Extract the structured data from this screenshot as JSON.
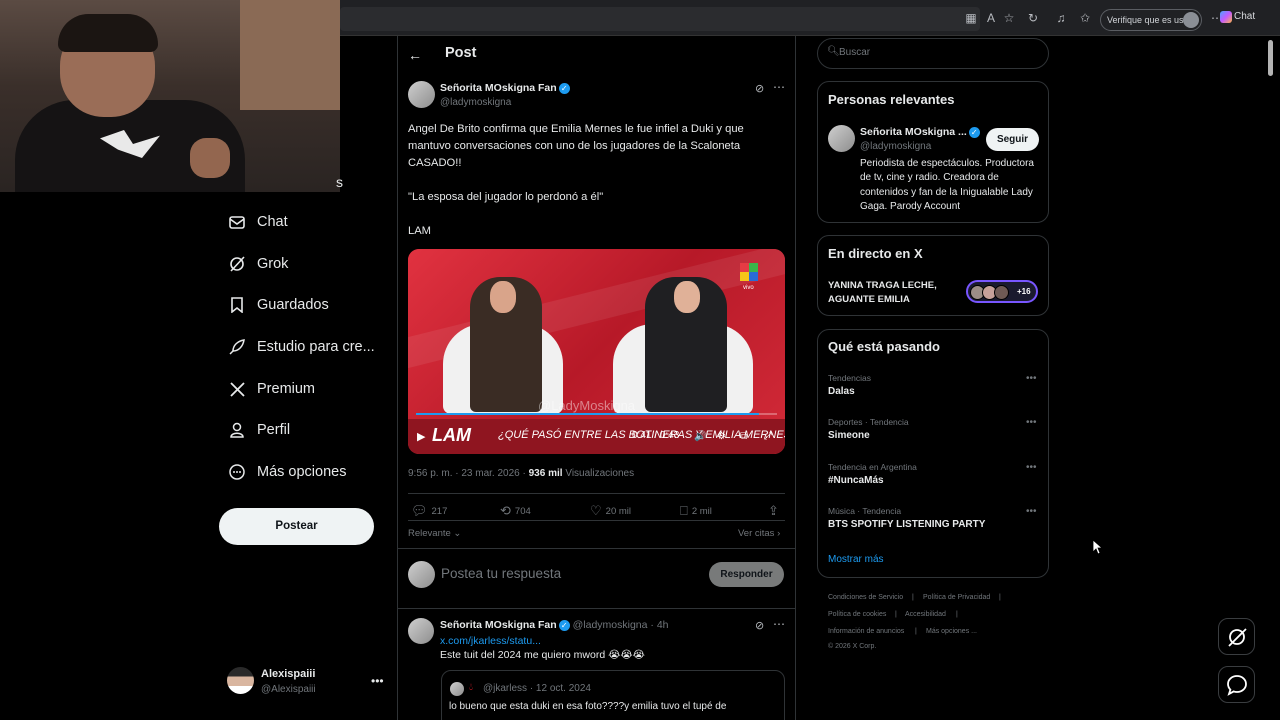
{
  "browser": {
    "verify_label": "Verifique que es usted",
    "copilot_label": "Chat"
  },
  "nav": {
    "partial_label": "s",
    "items": [
      {
        "label": "Chat",
        "icon": "mail-icon"
      },
      {
        "label": "Grok",
        "icon": "grok-icon"
      },
      {
        "label": "Guardados",
        "icon": "bookmark-icon"
      },
      {
        "label": "Estudio para cre...",
        "icon": "rocket-icon"
      },
      {
        "label": "Premium",
        "icon": "x-logo-icon"
      },
      {
        "label": "Perfil",
        "icon": "person-icon"
      },
      {
        "label": "Más opciones",
        "icon": "more-circle-icon"
      }
    ],
    "post_button": "Postear",
    "account": {
      "name": "Alexispaiii",
      "handle": "@Alexispaiii"
    }
  },
  "post_page": {
    "title": "Post",
    "tweet": {
      "author_name": "Señorita MOskigna Fan",
      "author_handle": "@ladymoskigna",
      "paragraphs": [
        "Angel De Brito confirma que Emilia Mernes le fue infiel a Duki y que mantuvo conversaciones con uno de los jugadores de la Scaloneta CASADO!!",
        "\"La esposa del jugador lo perdonó a él\"",
        "LAM"
      ],
      "media": {
        "watermark": "@LadyMoskigna",
        "channel_tag": "vivo",
        "show_logo": "LAM",
        "ticker": "¿QUÉ PASÓ ENTRE LAS BOTINERAS Y EMILIA MERNES?",
        "time": "0:41 / 0:43",
        "progress": 0.95
      },
      "time": "9:56 p. m. · 23 mar. 2026 ·",
      "views_count": "936 mil",
      "views_label": "Visualizaciones",
      "actions": {
        "replies": "217",
        "reposts": "704",
        "likes": "20 mil",
        "bookmarks": "2 mil"
      },
      "sort_label": "Relevante",
      "quotes_label": "Ver citas"
    },
    "reply": {
      "placeholder": "Postea tu respuesta",
      "button": "Responder"
    },
    "reply_tweet": {
      "author_name": "Señorita MOskigna Fan",
      "author_handle": "@ladymoskigna · 4h",
      "link": "x.com/jkarless/statu...",
      "text": "Este tuit del 2024 me quiero mword 😭😭😭",
      "quote": {
        "handle": "@jkarless · 12 oct. 2024",
        "text": "lo bueno que esta duki en esa foto????y emilia tuvo el tupé de"
      }
    }
  },
  "sidebar": {
    "search_placeholder": "Buscar",
    "relevant": {
      "title": "Personas relevantes",
      "name": "Señorita MOskigna ...",
      "handle": "@ladymoskigna",
      "follow": "Seguir",
      "bio": "Periodista de espectáculos. Productora de tv, cine y radio. Creadora de contenidos y fan de la Inigualable Lady Gaga. Parody Account"
    },
    "live": {
      "title": "En directo en X",
      "text": "YANINA TRAGA LECHE, AGUANTE EMILIA",
      "count": "+16"
    },
    "trending": {
      "title": "Qué está pasando",
      "items": [
        {
          "category": "Tendencias",
          "name": "Dalas"
        },
        {
          "category": "Deportes · Tendencia",
          "name": "Simeone"
        },
        {
          "category": "Tendencia en Argentina",
          "name": "#NuncaMás"
        },
        {
          "category": "Música · Tendencia",
          "name": "BTS SPOTIFY LISTENING PARTY"
        }
      ],
      "show_more": "Mostrar más"
    },
    "footer": {
      "links": [
        "Condiciones de Servicio",
        "Política de Privacidad",
        "Política de cookies",
        "Accesibilidad",
        "Información de anuncios",
        "Más opciones ..."
      ],
      "copyright": "© 2026 X Corp."
    }
  },
  "colors": {
    "accent": "#1d9bf0",
    "background": "#000000",
    "border": "#2f3336",
    "muted": "#71767b"
  }
}
